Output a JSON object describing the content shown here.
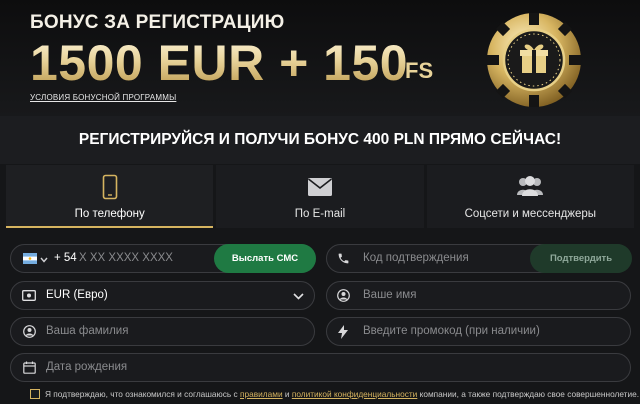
{
  "banner": {
    "title": "БОНУС ЗА РЕГИСТРАЦИЮ",
    "amount": "1500 EUR + 150",
    "amount_suffix": "FS",
    "terms_link": "УСЛОВИЯ БОНУСНОЙ ПРОГРАММЫ"
  },
  "headline": "РЕГИСТРИРУЙСЯ И ПОЛУЧИ БОНУС 400 PLN ПРЯМО СЕЙЧАС!",
  "tabs": [
    {
      "label": "По телефону",
      "icon": "phone-icon",
      "active": true
    },
    {
      "label": "По E-mail",
      "icon": "envelope-icon",
      "active": false
    },
    {
      "label": "Соцсети и мессенджеры",
      "icon": "users-icon",
      "active": false
    }
  ],
  "form": {
    "phone": {
      "country_code": "+ 54",
      "placeholder": "X XX XXXX XXXX",
      "flag": "argentina-flag-icon"
    },
    "send_sms_label": "Выслать СМС",
    "confirm_code_placeholder": "Код подтверждения",
    "confirm_label": "Подтвердить",
    "currency_value": "EUR (Евро)",
    "name_placeholder": "Ваше имя",
    "surname_placeholder": "Ваша фамилия",
    "promo_placeholder": "Введите промокод (при наличии)",
    "birthdate_placeholder": "Дата рождения"
  },
  "consent": {
    "text_before": "Я подтверждаю, что ознакомился и соглашаюсь с",
    "rules_link": "правилами",
    "and": "и",
    "privacy_link": "политикой конфиденциальности",
    "text_after": "компании, а также подтверждаю свое совершеннолетие."
  },
  "colors": {
    "accent_gold": "#d6b460",
    "green_button": "#1f7a43",
    "background": "#151618"
  }
}
